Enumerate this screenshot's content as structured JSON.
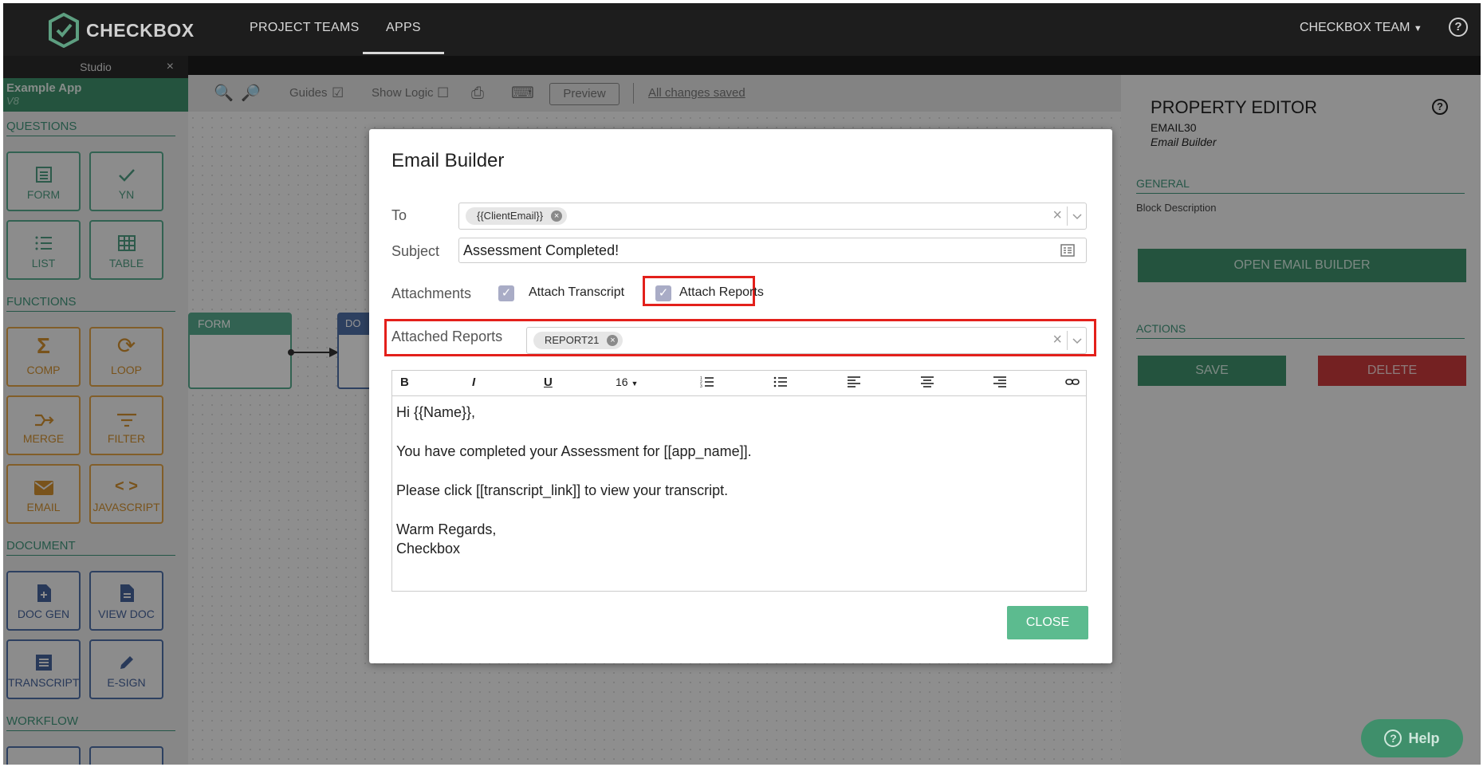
{
  "topbar": {
    "brand": "CHECKBOX",
    "nav": [
      "PROJECT TEAMS",
      "APPS"
    ],
    "team": "CHECKBOX TEAM",
    "help": "?"
  },
  "sidebar": {
    "studio_tab": "Studio",
    "close": "×",
    "app_name": "Example App",
    "app_version": "V8",
    "sections": {
      "questions": "QUESTIONS",
      "functions": "FUNCTIONS",
      "document": "DOCUMENT",
      "workflow": "WORKFLOW"
    },
    "tiles": {
      "form": "FORM",
      "yn": "YN",
      "list": "LIST",
      "table": "TABLE",
      "comp": "COMP",
      "loop": "LOOP",
      "merge": "MERGE",
      "filter": "FILTER",
      "email": "EMAIL",
      "javascript": "JAVASCRIPT",
      "doc_gen": "DOC GEN",
      "view_doc": "VIEW DOC",
      "transcript": "TRANSCRIPT",
      "esign": "E-SIGN"
    }
  },
  "toolbar": {
    "guides": "Guides",
    "show_logic": "Show Logic",
    "preview": "Preview",
    "saved": "All changes saved"
  },
  "canvas": {
    "form_node": "FORM",
    "doc_node": "DO"
  },
  "property_editor": {
    "title": "PROPERTY EDITOR",
    "help": "?",
    "id": "EMAIL30",
    "subtitle": "Email Builder",
    "general": "GENERAL",
    "block_description": "Block Description",
    "open_email_builder": "OPEN EMAIL BUILDER",
    "actions": "ACTIONS",
    "save": "SAVE",
    "delete": "DELETE"
  },
  "help_button": "Help",
  "modal": {
    "title": "Email Builder",
    "to_label": "To",
    "to_chip": "{{ClientEmail}}",
    "subject_label": "Subject",
    "subject_value": "Assessment Completed!",
    "attachments_label": "Attachments",
    "attach_transcript": "Attach Transcript",
    "attach_reports": "Attach Reports",
    "attached_reports_label": "Attached Reports",
    "report_chip": "REPORT21",
    "font_size": "16",
    "body": {
      "greeting": "Hi {{Name}},",
      "line1": "You have completed your Assessment for [[app_name]].",
      "line2": "Please click [[transcript_link]] to view your transcript.",
      "sign1": "Warm Regards,",
      "sign2": "Checkbox"
    },
    "close": "CLOSE"
  }
}
